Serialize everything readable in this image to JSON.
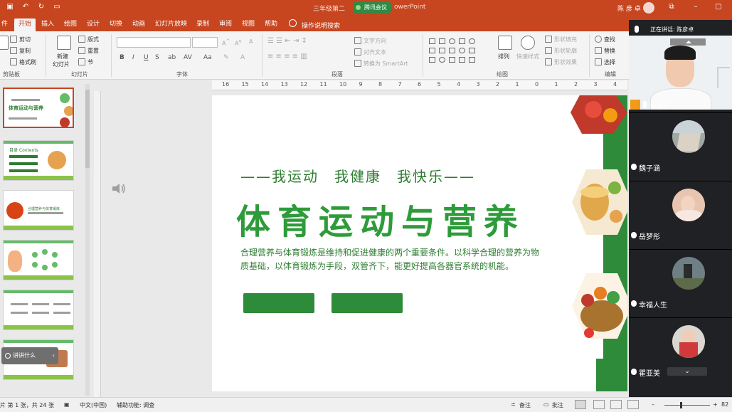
{
  "window": {
    "doc_title": "三年级第二",
    "doc_title_suffix": "owerPoint",
    "meeting_badge": "腾讯会议",
    "user_name": "陈 彦 卓"
  },
  "tabs": [
    "件",
    "开始",
    "插入",
    "绘图",
    "设计",
    "切换",
    "动画",
    "幻灯片放映",
    "录制",
    "审阅",
    "视图",
    "帮助"
  ],
  "tell_me": "操作说明搜索",
  "ribbon": {
    "clipboard": {
      "cut": "剪切",
      "copy": "复制",
      "format_painter": "格式刷",
      "label": "剪贴板"
    },
    "slides": {
      "new_slide": "新建",
      "new_slide_line2": "幻灯片",
      "layout": "版式",
      "reset": "重置",
      "section": "节",
      "label": "幻灯片"
    },
    "font": {
      "label": "字体",
      "bold": "B",
      "italic": "I",
      "underline": "U",
      "strike": "S"
    },
    "paragraph": {
      "text_direction": "文字方向",
      "align_text": "对齐文本",
      "smartart": "转换为 SmartArt",
      "label": "段落"
    },
    "drawing": {
      "arrange": "排列",
      "quick_styles": "快速样式",
      "shape_fill": "形状填充",
      "shape_outline": "形状轮廓",
      "shape_effects": "形状效果",
      "label": "绘图"
    },
    "editing": {
      "find": "查找",
      "replace": "替换",
      "select": "选择",
      "label": "编辑"
    }
  },
  "ruler_ticks": [
    "16",
    "15",
    "14",
    "13",
    "12",
    "11",
    "10",
    "9",
    "8",
    "7",
    "6",
    "5",
    "4",
    "3",
    "2",
    "1",
    "0",
    "1",
    "2",
    "3",
    "4"
  ],
  "thumbnails": {
    "slide1_title": "体育运动与营养",
    "slide2_label": "目录 Contents",
    "slide3_label": "合理营养与体育锻炼"
  },
  "overlay_pill": "讲讲什么",
  "slide": {
    "subtitle": "——我运动　我健康　我快乐——",
    "title": "体育运动与营养",
    "body": "合理营养与体育锻炼是维持和促进健康的两个重要条件。以科学合理的营养为物质基础，以体育锻炼为手段，双管齐下，能更好提高各器官系统的机能。"
  },
  "video_panel": {
    "speaking_label": "正在讲话: 陈彦卓",
    "main_speaker": "陈彦卓",
    "participants": [
      "魏子涵",
      "岳梦彤",
      "幸福人生",
      "瞿亚美"
    ],
    "collapse_icon": "chevron-up-icon",
    "expand_icon": "chevron-down-icon"
  },
  "statusbar": {
    "slide_count": "片 第 1 张，共 24 张",
    "language": "中文(中国)",
    "accessibility": "辅助功能: 调查",
    "notes": "备注",
    "comments": "批注",
    "zoom": "82"
  },
  "colors": {
    "accent": "#c7451f",
    "slide_green": "#2e9b3a",
    "panel_bg": "#202124"
  }
}
